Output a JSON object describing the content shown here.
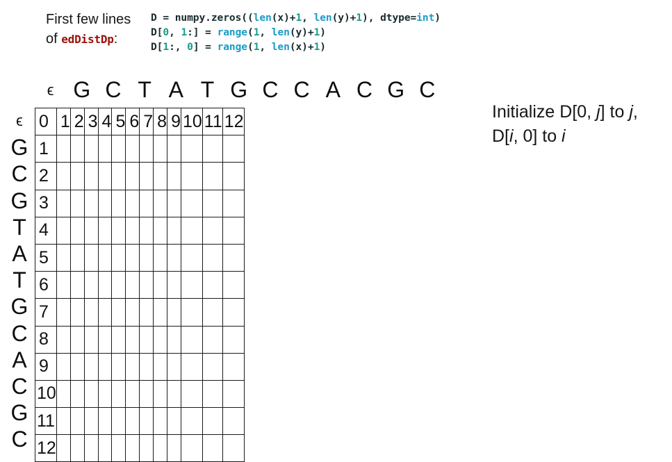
{
  "caption": {
    "line1": "First few lines",
    "line2_prefix": "of ",
    "line2_code": "edDistDp",
    "line2_suffix": ":"
  },
  "code": {
    "language": "python",
    "lines": [
      "D = numpy.zeros((len(x)+1, len(y)+1), dtype=int)",
      "D[0, 1:] = range(1, len(y)+1)",
      "D[1:, 0] = range(1, len(x)+1)"
    ],
    "line1": {
      "p1": "D = numpy.zeros((",
      "fn1": "len",
      "p2": "(x)+",
      "n1": "1",
      "p3": ", ",
      "fn2": "len",
      "p4": "(y)+",
      "n2": "1",
      "p5": "), dtype=",
      "kw1": "int",
      "p6": ")"
    },
    "line2": {
      "p1": "D[",
      "n1": "0",
      "p2": ", ",
      "n2": "1",
      "p3": ":] = ",
      "fn1": "range",
      "p4": "(",
      "n3": "1",
      "p5": ", ",
      "fn2": "len",
      "p6": "(y)+",
      "n4": "1",
      "p7": ")"
    },
    "line3": {
      "p1": "D[",
      "n1": "1",
      "p2": ":, ",
      "n2": "0",
      "p3": "] = ",
      "fn1": "range",
      "p4": "(",
      "n3": "1",
      "p5": ", ",
      "fn2": "len",
      "p6": "(x)+",
      "n4": "1",
      "p7": ")"
    },
    "colors": {
      "plain": "#1a2b2e",
      "function": "#1b9bc6",
      "number": "#179b8a",
      "keyword": "#1b9bc6"
    }
  },
  "matrix": {
    "epsilon": "ϵ",
    "column_headers": [
      "ϵ",
      "G",
      "C",
      "T",
      "A",
      "T",
      "G",
      "C",
      "C",
      "A",
      "C",
      "G",
      "C"
    ],
    "row_headers": [
      "ϵ",
      "G",
      "C",
      "G",
      "T",
      "A",
      "T",
      "G",
      "C",
      "A",
      "C",
      "G",
      "C"
    ],
    "rows": [
      [
        "0",
        "1",
        "2",
        "3",
        "4",
        "5",
        "6",
        "7",
        "8",
        "9",
        "10",
        "11",
        "12"
      ],
      [
        "1",
        "",
        "",
        "",
        "",
        "",
        "",
        "",
        "",
        "",
        "",
        "",
        ""
      ],
      [
        "2",
        "",
        "",
        "",
        "",
        "",
        "",
        "",
        "",
        "",
        "",
        "",
        ""
      ],
      [
        "3",
        "",
        "",
        "",
        "",
        "",
        "",
        "",
        "",
        "",
        "",
        "",
        ""
      ],
      [
        "4",
        "",
        "",
        "",
        "",
        "",
        "",
        "",
        "",
        "",
        "",
        "",
        ""
      ],
      [
        "5",
        "",
        "",
        "",
        "",
        "",
        "",
        "",
        "",
        "",
        "",
        "",
        ""
      ],
      [
        "6",
        "",
        "",
        "",
        "",
        "",
        "",
        "",
        "",
        "",
        "",
        "",
        ""
      ],
      [
        "7",
        "",
        "",
        "",
        "",
        "",
        "",
        "",
        "",
        "",
        "",
        "",
        ""
      ],
      [
        "8",
        "",
        "",
        "",
        "",
        "",
        "",
        "",
        "",
        "",
        "",
        "",
        ""
      ],
      [
        "9",
        "",
        "",
        "",
        "",
        "",
        "",
        "",
        "",
        "",
        "",
        "",
        ""
      ],
      [
        "10",
        "",
        "",
        "",
        "",
        "",
        "",
        "",
        "",
        "",
        "",
        "",
        ""
      ],
      [
        "11",
        "",
        "",
        "",
        "",
        "",
        "",
        "",
        "",
        "",
        "",
        "",
        ""
      ],
      [
        "12",
        "",
        "",
        "",
        "",
        "",
        "",
        "",
        "",
        "",
        "",
        "",
        ""
      ]
    ],
    "border_color": "#1a1a1a",
    "cell_background": "#ffffff"
  },
  "annotation": {
    "l1_a": "Initialize D[0, ",
    "l1_i1": "j",
    "l1_b": "] to ",
    "l1_i2": "j",
    "l1_c": ",",
    "l2_a": "D[",
    "l2_i1": "i",
    "l2_b": ", 0] to ",
    "l2_i2": "i"
  }
}
